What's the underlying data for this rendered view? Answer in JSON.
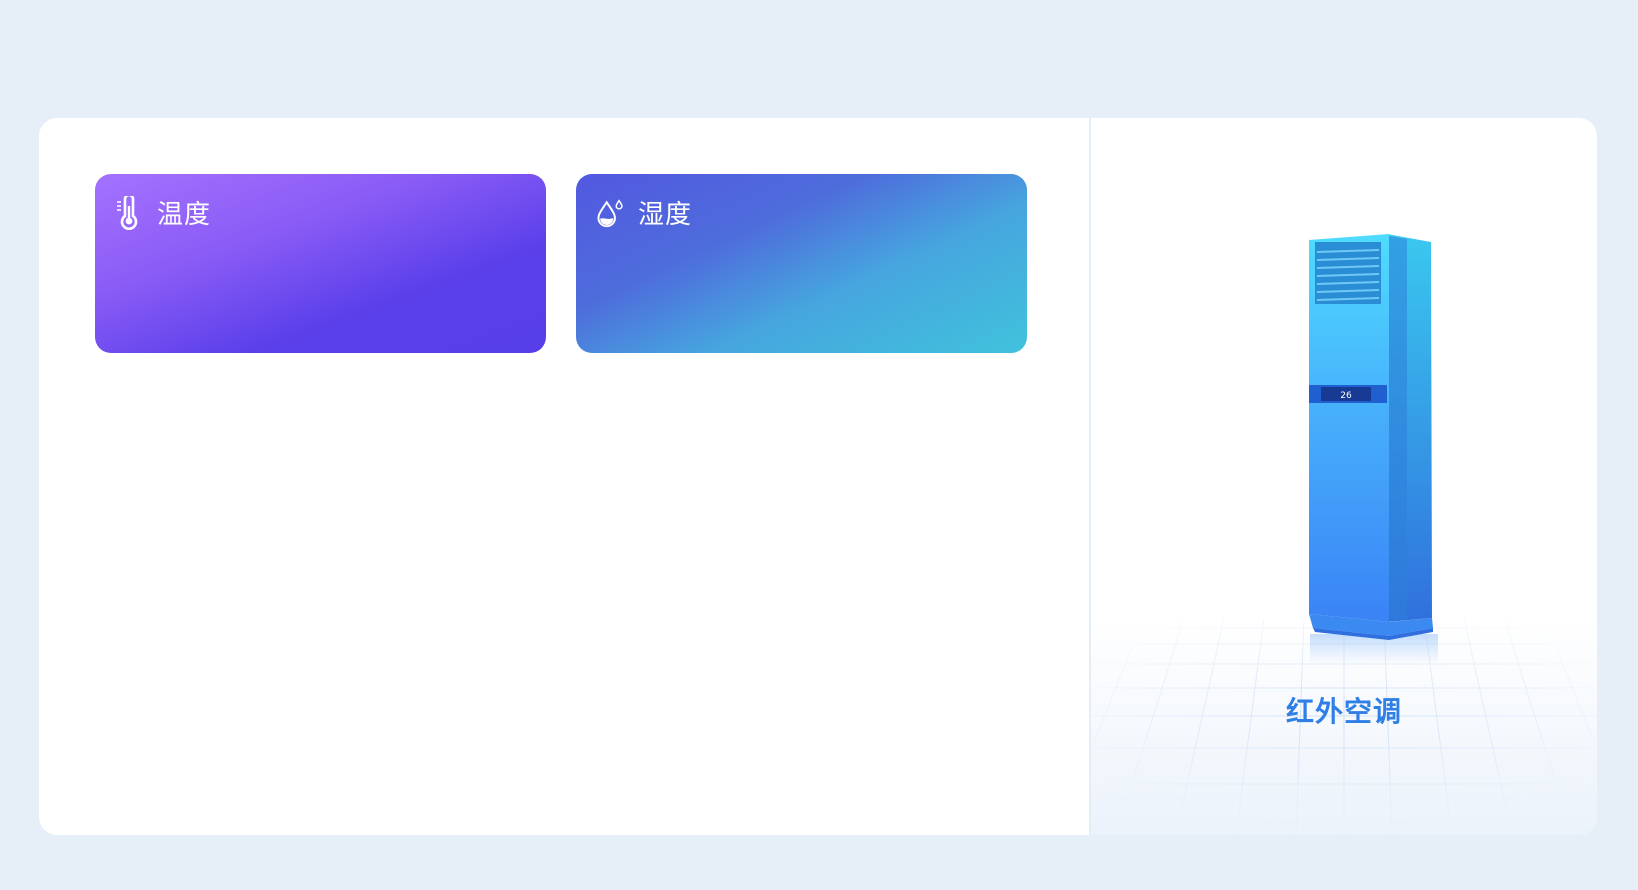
{
  "sensors": {
    "temperature": {
      "label": "温度",
      "icon": "thermometer-icon"
    },
    "humidity": {
      "label": "湿度",
      "icon": "water-drop-icon"
    }
  },
  "device": {
    "name": "红外空调",
    "display_value": "26",
    "image": "floor-standing-air-conditioner"
  },
  "colors": {
    "page_background": "#e6eef8",
    "temperature_gradient": [
      "#a472ff",
      "#553ee8"
    ],
    "humidity_gradient": [
      "#5258e0",
      "#40c2dc"
    ],
    "device_name": "#2f7fe6"
  }
}
